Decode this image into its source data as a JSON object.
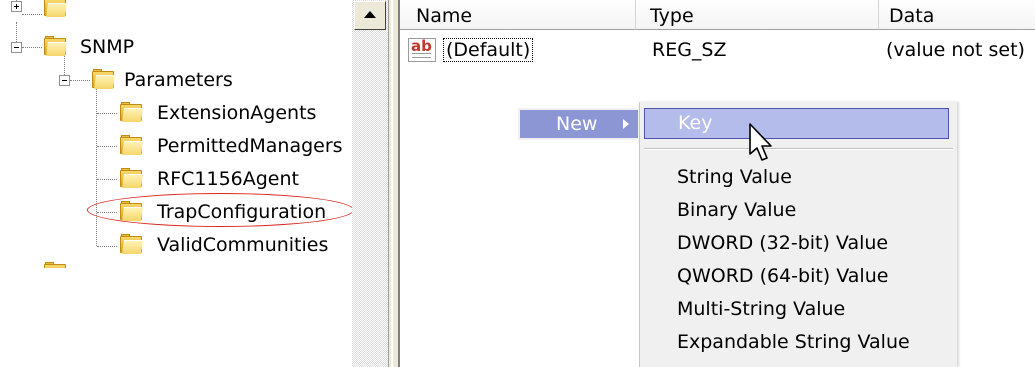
{
  "tree": {
    "items": [
      {
        "label": ""
      },
      {
        "label": "SNMP"
      },
      {
        "label": "Parameters"
      },
      {
        "label": "ExtensionAgents"
      },
      {
        "label": "PermittedManagers"
      },
      {
        "label": "RFC1156Agent"
      },
      {
        "label": "TrapConfiguration"
      },
      {
        "label": "ValidCommunities"
      }
    ],
    "highlighted_item": "TrapConfiguration"
  },
  "list": {
    "columns": {
      "name": "Name",
      "type": "Type",
      "data": "Data"
    },
    "rows": [
      {
        "name": "(Default)",
        "type": "REG_SZ",
        "data": "(value not set)",
        "icon": "string-value-icon"
      }
    ]
  },
  "context_menu": {
    "item": "New",
    "submenu": {
      "highlighted": "Key",
      "items": [
        "String Value",
        "Binary Value",
        "DWORD (32-bit) Value",
        "QWORD (64-bit) Value",
        "Multi-String Value",
        "Expandable String Value"
      ]
    }
  },
  "colors": {
    "menu_highlight": "#8c96d4",
    "submenu_highlight": "#b4bcec",
    "annotation_oval": "#d9261c",
    "folder": "#e8b932"
  }
}
